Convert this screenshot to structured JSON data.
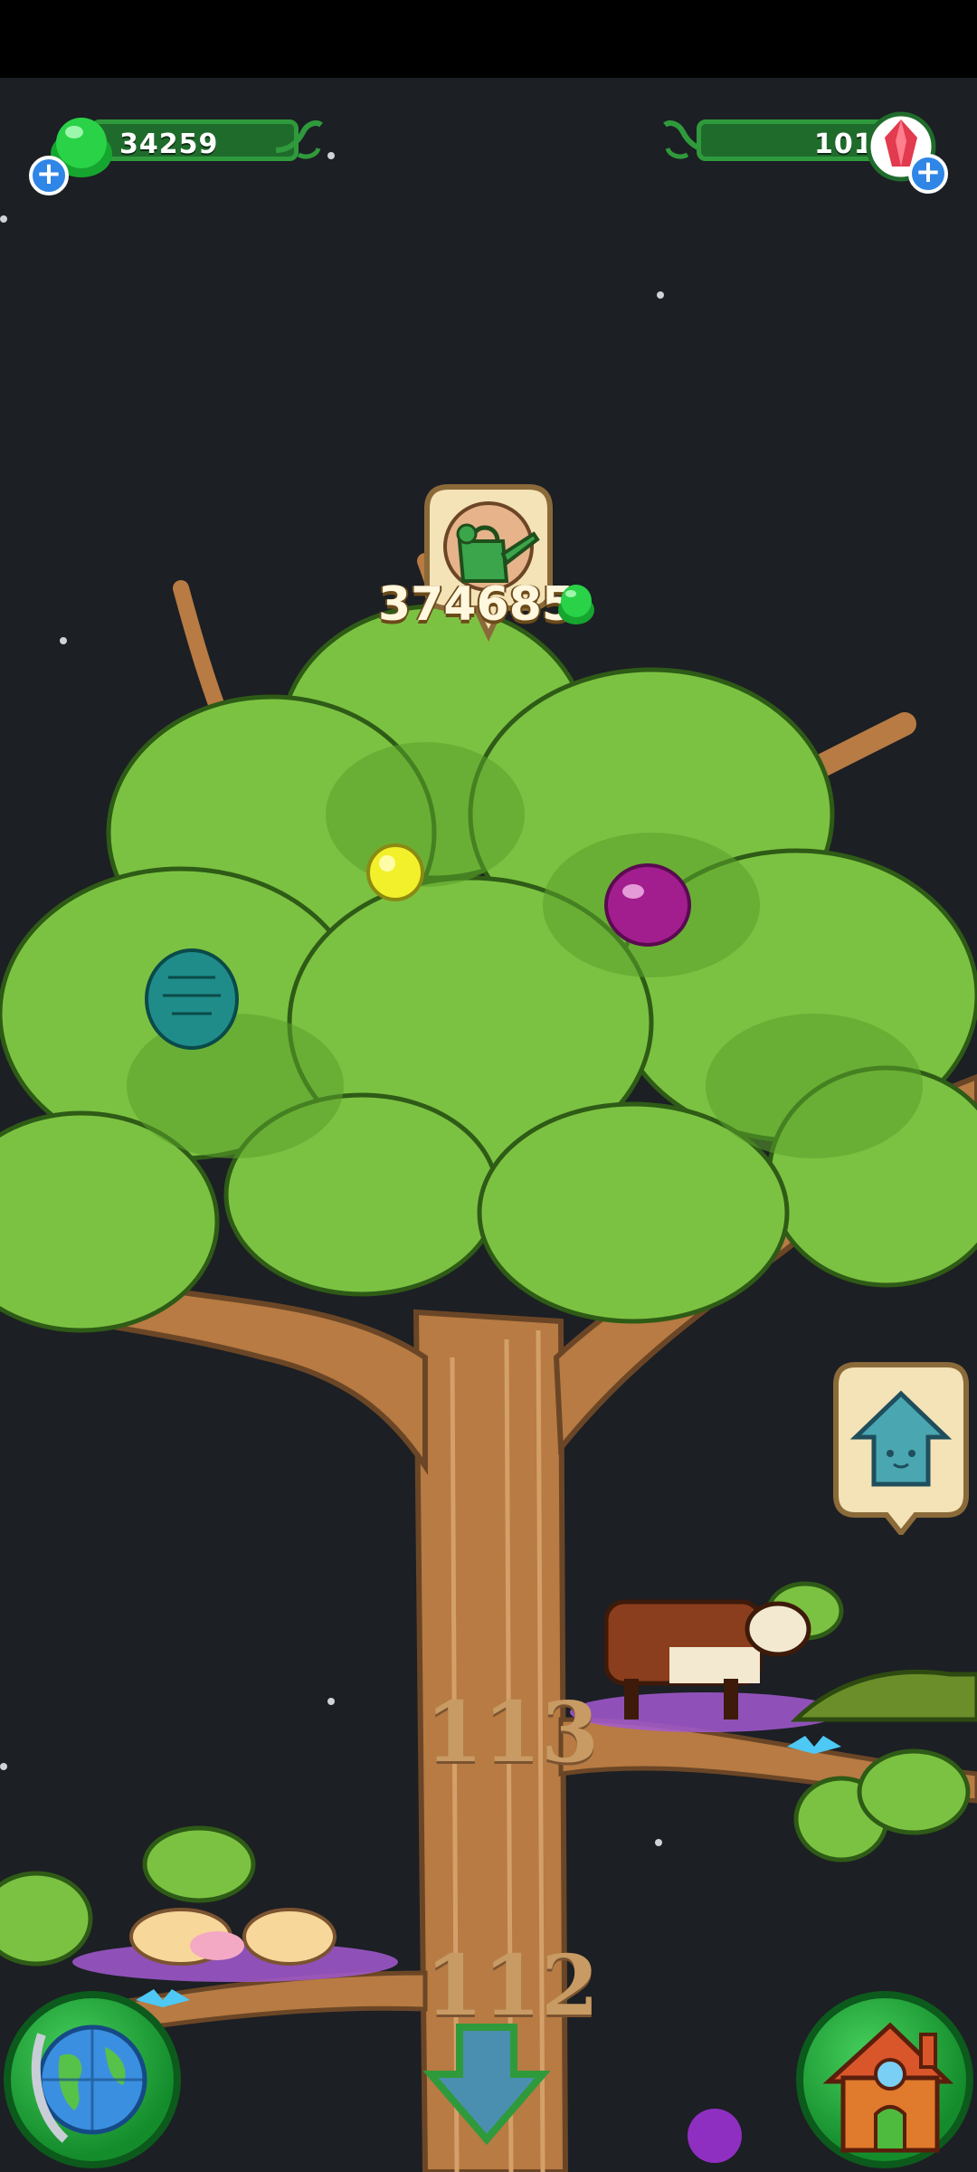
{
  "hud": {
    "gems_green": "34259",
    "gems_red": "101",
    "plus_symbol": "+"
  },
  "tree": {
    "watering_cost": "374685",
    "branch_numbers": [
      "113",
      "112"
    ]
  },
  "icons": {
    "watering": "watering-can-icon",
    "home_up": "home-up-arrow-icon",
    "down": "down-arrow-icon",
    "globe": "globe-icon",
    "house": "house-icon"
  },
  "colors": {
    "background": "#1c1f24",
    "leaf": "#7cc242",
    "trunk": "#b77b43",
    "green_pill": "#1f6b2c"
  }
}
